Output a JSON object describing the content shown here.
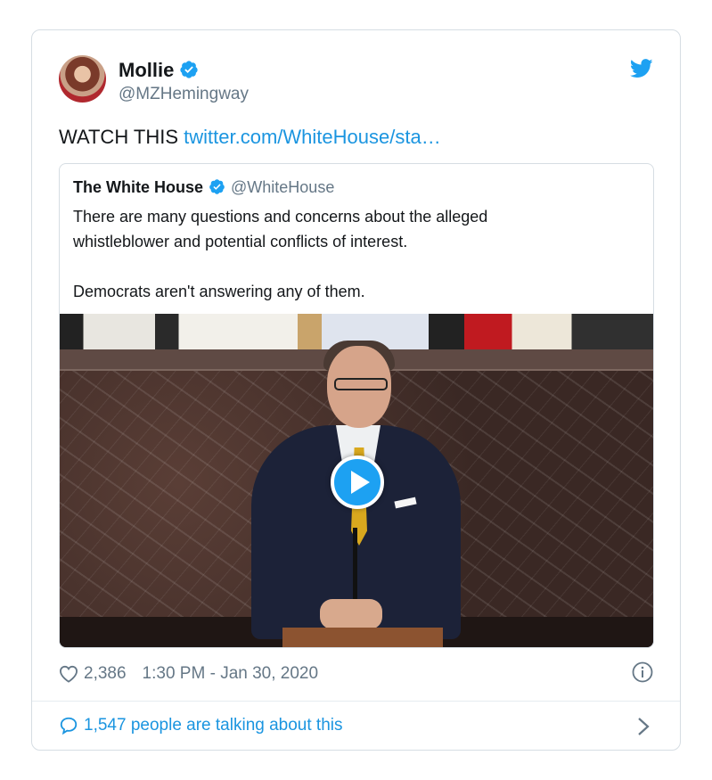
{
  "author": {
    "name": "Mollie",
    "handle": "@MZHemingway"
  },
  "tweet": {
    "text": "WATCH THIS",
    "link": "twitter.com/WhiteHouse/sta…"
  },
  "quoted": {
    "name": "The White House",
    "handle": "@WhiteHouse",
    "text": "There are many questions and concerns about the alleged\nwhistleblower and potential conflicts of interest.\n\nDemocrats aren't answering any of them."
  },
  "meta": {
    "likes": "2,386",
    "timestamp": "1:30 PM - Jan 30, 2020"
  },
  "footer": {
    "talking": "1,547 people are talking about this"
  },
  "colors": {
    "accent": "#1da1f2",
    "link": "#1b95e0",
    "muted": "#657786"
  },
  "icons": [
    "verified-badge-icon",
    "twitter-bird-icon",
    "play-icon",
    "heart-icon",
    "info-icon",
    "speech-bubble-icon",
    "chevron-right-icon"
  ]
}
